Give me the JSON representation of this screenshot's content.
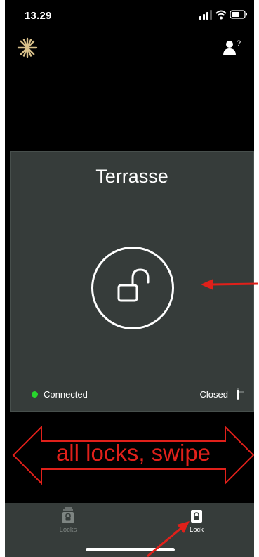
{
  "status_bar": {
    "time": "13.29"
  },
  "header": {
    "logo_icon": "snowflake-star-logo",
    "help_icon": "user-help-icon"
  },
  "lock_card": {
    "name": "Terrasse",
    "lock_state_icon": "unlocked-padlock-icon",
    "connection_label": "Connected",
    "connection_color": "#27d62c",
    "door_state_label": "Closed",
    "door_state_icon": "door-handle-icon"
  },
  "annotations": {
    "swipe_label": "all locks, swipe",
    "annotation_color": "#e0201a"
  },
  "tab_bar": {
    "tabs": [
      {
        "label": "Locks",
        "icon": "locks-stack-icon",
        "active": false
      },
      {
        "label": "Lock",
        "icon": "lock-icon",
        "active": true
      }
    ]
  },
  "colors": {
    "background": "#000000",
    "card": "#363c3a",
    "tab_bar": "#363c3a",
    "logo": "#d8c08a"
  }
}
